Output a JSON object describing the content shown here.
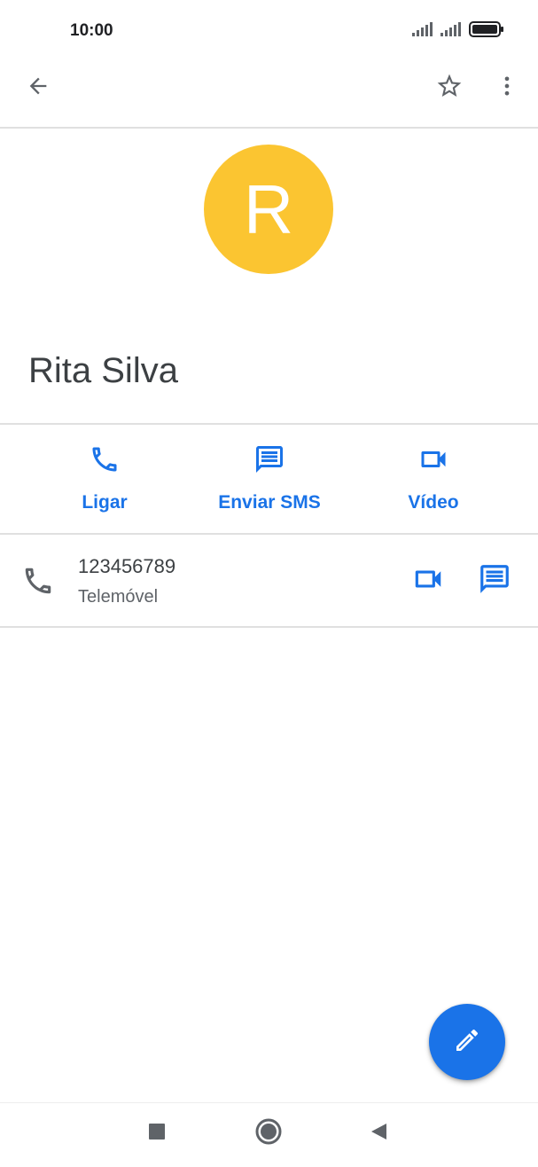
{
  "status_bar": {
    "time": "10:00",
    "icons": [
      "signal-icon",
      "signal-icon",
      "battery-icon"
    ]
  },
  "app_bar": {
    "back_icon": "arrow-back-icon",
    "star_icon": "star-outline-icon",
    "more_icon": "more-vert-icon"
  },
  "contact": {
    "initial": "R",
    "name": "Rita Silva",
    "avatar_color": "#FBC531"
  },
  "actions": [
    {
      "label": "Ligar",
      "icon": "phone-icon"
    },
    {
      "label": "Enviar SMS",
      "icon": "message-icon"
    },
    {
      "label": "Vídeo",
      "icon": "videocam-icon"
    }
  ],
  "phone_entry": {
    "number": "123456789",
    "type": "Telemóvel",
    "icon": "phone-icon",
    "video_icon": "videocam-icon",
    "message_icon": "message-icon"
  },
  "fab": {
    "icon": "edit-icon"
  },
  "nav_bar": {
    "icons": [
      "recents-square-icon",
      "home-circle-icon",
      "back-triangle-icon"
    ]
  },
  "colors": {
    "accent": "#1A73E8",
    "icon_grey": "#5f6368",
    "divider": "#e0e0e0",
    "fab": "#1A73E8"
  }
}
